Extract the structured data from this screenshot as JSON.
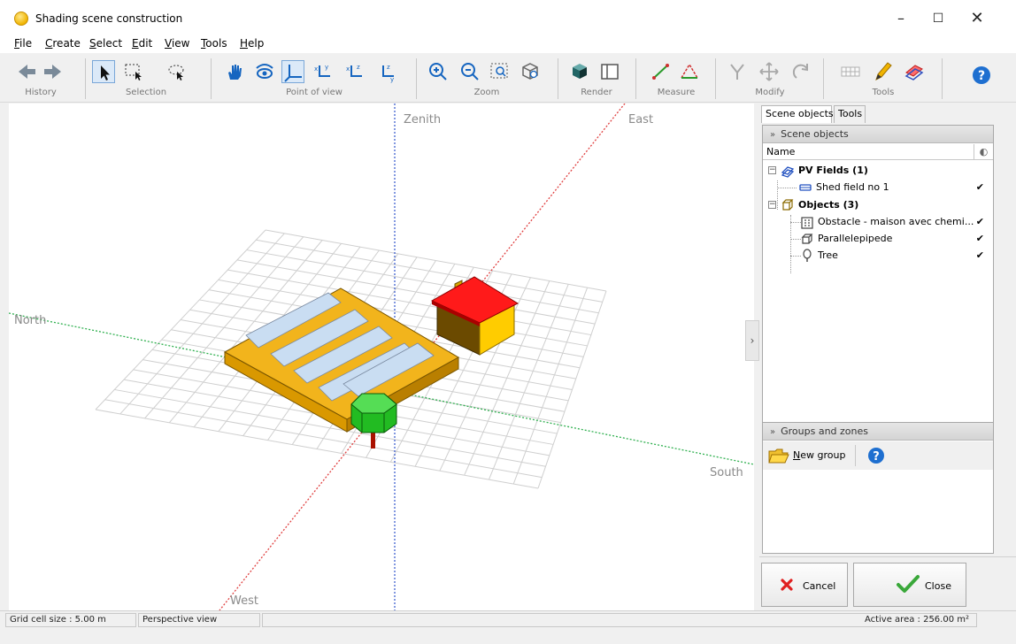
{
  "window": {
    "title": "Shading scene construction",
    "min_glyph": "–",
    "max_glyph": "☐",
    "close_glyph": "✕"
  },
  "menu": [
    {
      "label": "File"
    },
    {
      "label": "Create"
    },
    {
      "label": "Select"
    },
    {
      "label": "Edit"
    },
    {
      "label": "View"
    },
    {
      "label": "Tools"
    },
    {
      "label": "Help"
    }
  ],
  "toolbar": {
    "groups": {
      "history": "History",
      "selection": "Selection",
      "point_of_view": "Point of view",
      "zoom": "Zoom",
      "render": "Render",
      "measure": "Measure",
      "modify": "Modify",
      "tools": "Tools"
    }
  },
  "viewport": {
    "labels": {
      "zenith": "Zenith",
      "east": "East",
      "north": "North",
      "south": "South",
      "west": "West"
    },
    "collapse_glyph": "›"
  },
  "panel": {
    "tabs": [
      {
        "label": "Scene objects"
      },
      {
        "label": "Tools"
      }
    ],
    "scene_objects_header": "Scene objects",
    "name_column": "Name",
    "tree": {
      "pv_fields": {
        "label": "PV Fields (1)",
        "children": [
          {
            "label": "Shed field no 1",
            "checked": "✔"
          }
        ]
      },
      "objects": {
        "label": "Objects (3)",
        "children": [
          {
            "label": "Obstacle - maison avec chemi...",
            "checked": "✔"
          },
          {
            "label": "Parallelepipede",
            "checked": "✔"
          },
          {
            "label": "Tree",
            "checked": "✔"
          }
        ]
      }
    },
    "groups_header": "Groups and zones",
    "new_group_label": "New group",
    "chevrons": "»",
    "toggle_minus": "−"
  },
  "buttons": {
    "cancel": "Cancel",
    "close": "Close"
  },
  "status": {
    "grid_cell": "Grid cell size :  5.00 m",
    "view_mode": "Perspective view",
    "active_area": "Active area : 256.00 m²"
  },
  "colors": {
    "roof": "#ff1a1a",
    "house_wall": "#ffcc00",
    "field_base": "#e8a800",
    "panels": "#c9ddf2",
    "tree_crown": "#22bb22",
    "trunk": "#aa1100",
    "axis_red": "#e04040",
    "axis_blue": "#4060d0",
    "axis_green": "#30b050",
    "accent_blue": "#1565c0"
  }
}
